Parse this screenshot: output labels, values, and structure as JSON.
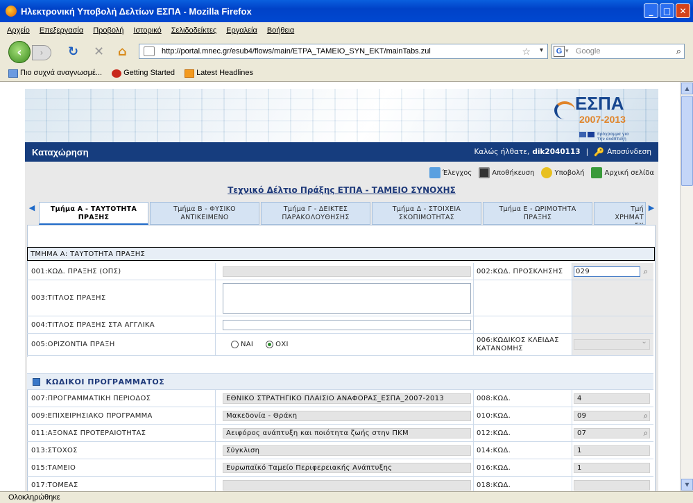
{
  "window": {
    "title": "Ηλεκτρονική Υποβολή Δελτίων ΕΣΠΑ - Mozilla Firefox"
  },
  "menu": [
    "Αρχείο",
    "Επεξεργασία",
    "Προβολή",
    "Ιστορικό",
    "Σελιδοδείκτες",
    "Εργαλεία",
    "Βοήθεια"
  ],
  "url": "http://portal.mnec.gr/esub4/flows/main/ETPA_TAMEIO_SYN_EKT/mainTabs.zul",
  "search": {
    "placeholder": "Google"
  },
  "bookmarks": [
    "Πιο συχνά αναγνωσμέ...",
    "Getting Started",
    "Latest Headlines"
  ],
  "status": "Ολοκληρώθηκε",
  "banner": {
    "logo_main": "ΕΣΠΑ",
    "logo_years": "2007-2013",
    "logo_sub": "πρόγραμμα για την ανάπτυξη"
  },
  "header": {
    "page_title": "Καταχώρηση",
    "greeting": "Καλώς ήλθατε,",
    "username": "dik2040113",
    "separator": "|",
    "logout": "Αποσύνδεση"
  },
  "actions": {
    "check": "Έλεγχος",
    "save": "Αποθήκευση",
    "submit": "Υποβολή",
    "home": "Αρχική σελίδα"
  },
  "doc_title": "Τεχνικό Δέλτιο Πράξης ΕΤΠΑ - ΤΑΜΕΙΟ ΣΥΝΟΧΗΣ",
  "tabs": [
    {
      "line1": "Τμήμα Α - ΤΑΥΤΟΤΗΤΑ",
      "line2": "ΠΡΑΞΗΣ"
    },
    {
      "line1": "Τμήμα Β - ΦΥΣΙΚΟ",
      "line2": "ΑΝΤΙΚΕΙΜΕΝΟ"
    },
    {
      "line1": "Τμήμα Γ - ΔΕΙΚΤΕΣ",
      "line2": "ΠΑΡΑΚΟΛΟΥΘΗΣΗΣ"
    },
    {
      "line1": "Τμήμα Δ - ΣΤΟΙΧΕΙΑ",
      "line2": "ΣΚΟΠΙΜΟΤΗΤΑΣ"
    },
    {
      "line1": "Τμήμα Ε - ΩΡΙΜΟΤΗΤΑ",
      "line2": "ΠΡΑΞΗΣ"
    },
    {
      "line1": "Τμή",
      "line2": "ΧΡΗΜΑΤ",
      "line3": "ΣΧ"
    }
  ],
  "section": "ΤΜΗΜΑ Α: ΤΑΥΤΟΤΗΤΑ ΠΡΑΞΗΣ",
  "form": {
    "f001": "001:ΚΩΔ. ΠΡΑΞΗΣ (ΟΠΣ)",
    "f002": "002:ΚΩΔ. ΠΡΟΣΚΛΗΣΗΣ",
    "f002_value": "029",
    "f003": "003:ΤΙΤΛΟΣ ΠΡΑΞΗΣ",
    "f004": "004:ΤΙΤΛΟΣ ΠΡΑΞΗΣ ΣΤΑ ΑΓΓΛΙΚΑ",
    "f005": "005:ΟΡΙΖΟΝΤΙΑ ΠΡΑΞΗ",
    "f005_yes": "ΝΑΙ",
    "f005_no": "ΟΧΙ",
    "f005_selected": "ΟΧΙ",
    "f006": "006:ΚΩΔΙΚΟΣ ΚΛΕΙΔΑΣ ΚΑΤΑΝΟΜΗΣ"
  },
  "program_header": "ΚΩΔΙΚΟΙ ΠΡΟΓΡΑΜΜΑΤΟΣ",
  "program_rows": [
    {
      "label": "007:ΠΡΟΓΡΑΜΜΑΤΙΚΗ ΠΕΡΙΟΔΟΣ",
      "value": "ΕΘΝΙΚΟ ΣΤΡΑΤΗΓΙΚΟ ΠΛΑΙΣΙΟ ΑΝΑΦΟΡΑΣ_ΕΣΠΑ_2007-2013",
      "code_label": "008:ΚΩΔ.",
      "code": "4",
      "lookup": false
    },
    {
      "label": "009:ΕΠΙΧΕΙΡΗΣΙΑΚΟ ΠΡΟΓΡΑΜΜΑ",
      "value": "Μακεδονία - Θράκη",
      "code_label": "010:ΚΩΔ.",
      "code": "09",
      "lookup": true
    },
    {
      "label": "011:ΑΞΟΝΑΣ ΠΡΟΤΕΡΑΙΟΤΗΤΑΣ",
      "value": "Αειφόρος ανάπτυξη και ποιότητα ζωής στην ΠΚΜ",
      "code_label": "012:ΚΩΔ.",
      "code": "07",
      "lookup": true
    },
    {
      "label": "013:ΣΤΟΧΟΣ",
      "value": "Σύγκλιση",
      "code_label": "014:ΚΩΔ.",
      "code": "1",
      "lookup": false
    },
    {
      "label": "015:ΤΑΜΕΙΟ",
      "value": "Ευρωπαϊκό Ταμείο Περιφερειακής Ανάπτυξης",
      "code_label": "016:ΚΩΔ.",
      "code": "1",
      "lookup": false
    },
    {
      "label": "017:ΤΟΜΕΑΣ",
      "value": "",
      "code_label": "018:ΚΩΔ.",
      "code": "",
      "lookup": false
    }
  ]
}
